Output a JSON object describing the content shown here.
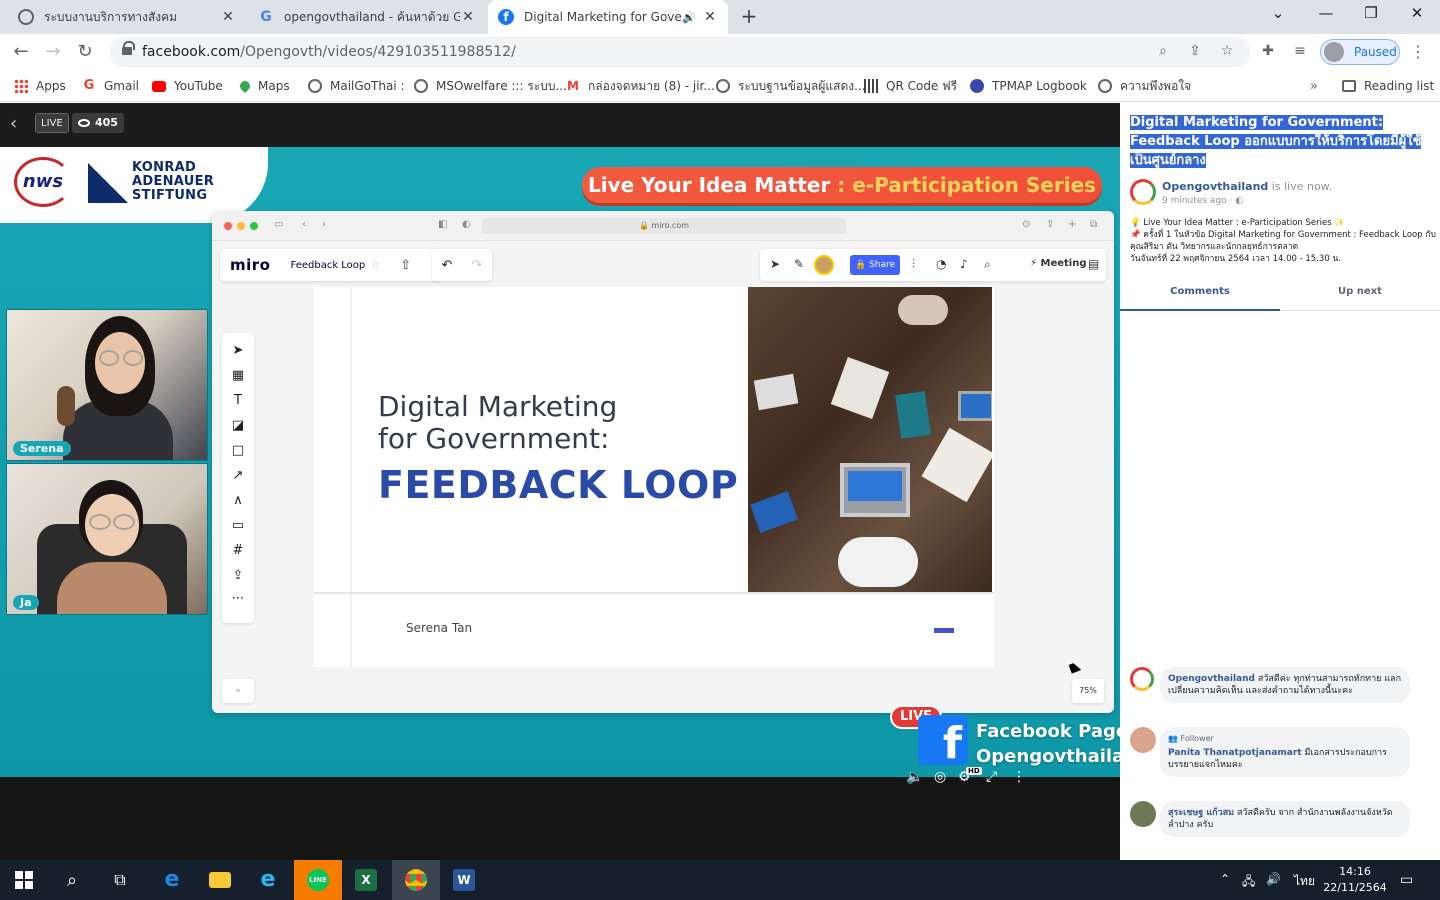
{
  "tabs": [
    {
      "title": "ระบบงานบริการทางสังคม",
      "close": "✕"
    },
    {
      "title": "opengovthailand - ค้นหาด้วย Goo",
      "close": "✕"
    },
    {
      "title": "Digital Marketing for Govern",
      "close": "✕",
      "active": true
    }
  ],
  "window": {
    "new_tab": "+",
    "chevron": "⌄",
    "minimize": "—",
    "restore": "❐",
    "close": "✕"
  },
  "address": {
    "host": "facebook.com",
    "path": "/Opengovth/videos/429103511988512/"
  },
  "profile": {
    "status": "Paused"
  },
  "bookmarks": [
    {
      "label": "Apps"
    },
    {
      "label": "Gmail"
    },
    {
      "label": "YouTube"
    },
    {
      "label": "Maps"
    },
    {
      "label": "MailGoThai :"
    },
    {
      "label": "MSOwelfare ::: ระบบ..."
    },
    {
      "label": "กล่องจดหมาย (8) - jir..."
    },
    {
      "label": "ระบบฐานข้อมูลผู้แสดง..."
    },
    {
      "label": "QR Code ฟรี"
    },
    {
      "label": "TPMAP Logbook"
    },
    {
      "label": "ความพึงพอใจ"
    }
  ],
  "bookmarks_more": "»",
  "reading_list": "Reading list",
  "video": {
    "live_label": "LIVE",
    "viewer_count": "405",
    "logo_nws": "nws",
    "logo_kas": [
      "KONRAD",
      "ADENAUER",
      "STIFTUNG"
    ],
    "banner_main": "Live Your Idea Matter",
    "banner_colon": " : ",
    "banner_series": "e-Participation Series",
    "participants": [
      "Serena",
      "Ja"
    ],
    "live_badge": "LIVE",
    "fb_page_line1": "Facebook Page",
    "fb_page_line2": "Opengovthailand",
    "hd": "HD"
  },
  "miro": {
    "url": "miro.com",
    "logo": "miro",
    "board_name": "Feedback Loop",
    "share": "Share",
    "meeting": "Meeting",
    "slide_title_1": "Digital Marketing",
    "slide_title_2": "for Government:",
    "slide_big": "FEEDBACK LOOP",
    "slide_author": "Serena Tan",
    "zoom": "75%",
    "expand": "»"
  },
  "panel": {
    "title": "Digital Marketing for Government: Feedback Loop ออกแบบการให้บริการโดยมีผู้ใช้เป็นศูนย์กลาง",
    "page_name": "Opengovthailand",
    "live_now": " is live now.",
    "time": "9 minutes ago · ",
    "desc_1": "💡 Live Your Idea Matter : e-Participation Series ✨",
    "desc_2": "📌 ครั้งที่ 1 ในหัวข้อ Digital Marketing for Government : Feedback Loop กับคุณสิริมา ตัน วิทยากรและนักกลยุทธ์การตลาด",
    "desc_3": "วันจันทร์ที่ 22 พฤศจิกายน 2564 เวลา 14.00 - 15.30 น.",
    "tab_comments": "Comments",
    "tab_upnext": "Up next",
    "comments": [
      {
        "name": "Opengovthailand",
        "text": " สวัสดีค่ะ ทุกท่านสามารถทักทาย แลกเปลี่ยนความคิดเห็น และส่งคำถามได้ทางนี้นะคะ"
      },
      {
        "badge": "👥 Follower",
        "name": "Panita Thanatpotjanamart",
        "text": " มีเอกสารประกอบการบรรยายแจกไหมคะ"
      },
      {
        "name": "สุระเชษฐ แก้วสม",
        "text": " สวัสดีครับ จาก สำนักงานพลังงานจังหวัดลำปาง ครับ"
      }
    ]
  },
  "taskbar": {
    "time": "14:16",
    "date": "22/11/2564",
    "lang": "ไทย"
  },
  "colors": {
    "fb_blue": "#1877f2",
    "stage_teal": "#18a6b5",
    "banner_red": "#f35b3f",
    "slide_blue": "#2a4aa8",
    "miro_share": "#4262ff"
  }
}
